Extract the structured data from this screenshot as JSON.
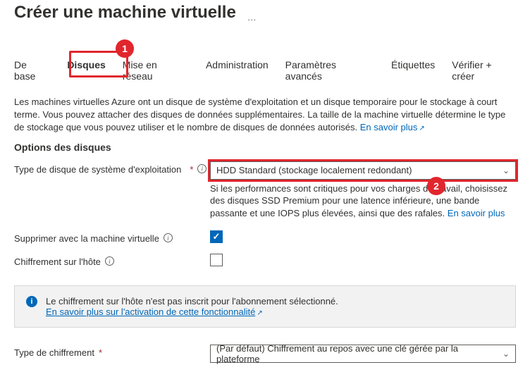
{
  "page": {
    "title": "Créer une machine virtuelle",
    "ellipsis": "…"
  },
  "tabs": {
    "base": "De base",
    "disks": "Disques",
    "network": "Mise en réseau",
    "admin": "Administration",
    "advanced": "Paramètres avancés",
    "tags": "Étiquettes",
    "review": "Vérifier + créer"
  },
  "annotations": {
    "badge1": "1",
    "badge2": "2"
  },
  "intro": {
    "text": "Les machines virtuelles Azure ont un disque de système d'exploitation et un disque temporaire pour le stockage à court terme. Vous pouvez attacher des disques de données supplémentaires. La taille de la machine virtuelle détermine le type de stockage que vous pouvez utiliser et le nombre de disques de données autorisés.",
    "link": "En savoir plus"
  },
  "section": {
    "title": "Options des disques"
  },
  "fields": {
    "osDisk": {
      "label": "Type de disque de système d'exploitation",
      "required": "*",
      "value": "HDD Standard (stockage localement redondant)",
      "helper": "Si les performances sont critiques pour vos charges de travail, choisissez des disques SSD Premium pour une latence inférieure, une bande passante et une IOPS plus élevées, ainsi que des rafales.",
      "helperLink": "En savoir plus"
    },
    "deleteWithVm": {
      "label": "Supprimer avec la machine virtuelle",
      "checked": true
    },
    "encryptHost": {
      "label": "Chiffrement sur l'hôte",
      "checked": false
    },
    "encryptType": {
      "label": "Type de chiffrement",
      "required": "*",
      "value": "(Par défaut) Chiffrement au repos avec une clé gérée par la plateforme"
    }
  },
  "callout": {
    "text": "Le chiffrement sur l'hôte n'est pas inscrit pour l'abonnement sélectionné.",
    "link": "En savoir plus sur l'activation de cette fonctionnalité"
  }
}
